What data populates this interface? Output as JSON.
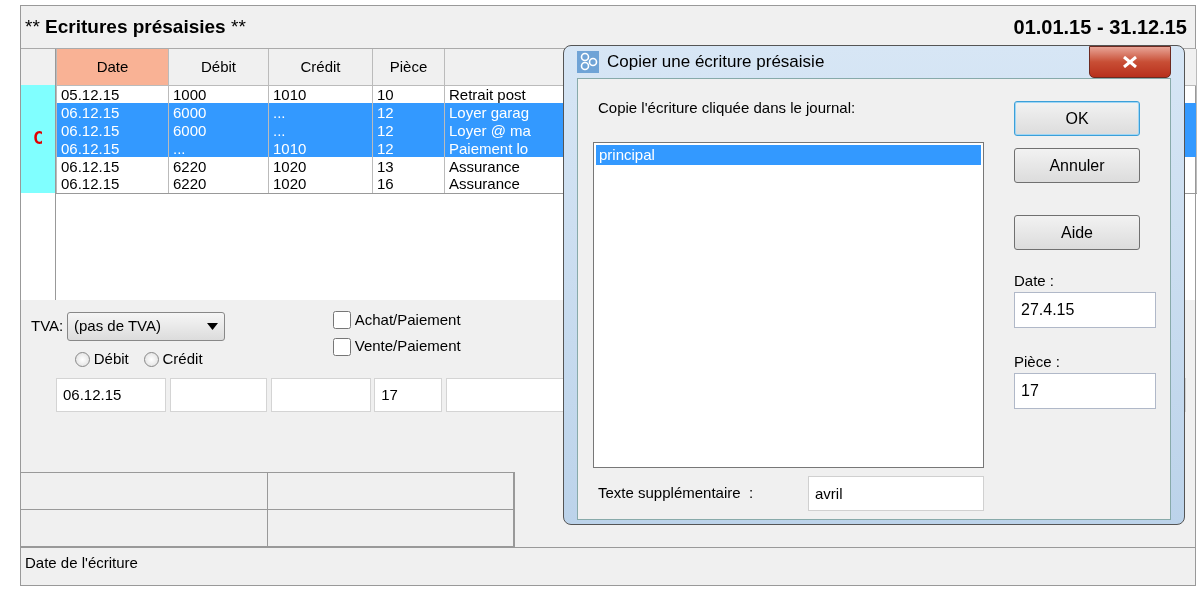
{
  "main": {
    "title_prefix": "**",
    "title": "Ecritures présaisies",
    "title_suffix": "**",
    "period": "01.01.15 - 31.12.15",
    "table": {
      "marker": "C",
      "columns": [
        {
          "label": "Date",
          "sorted": true
        },
        {
          "label": "Débit",
          "sorted": false
        },
        {
          "label": "Crédit",
          "sorted": false
        },
        {
          "label": "Pièce",
          "sorted": false
        }
      ],
      "rows": [
        {
          "cells": [
            "05.12.15",
            "1000",
            "1010",
            "10",
            "Retrait post"
          ],
          "selected": false
        },
        {
          "cells": [
            "06.12.15",
            "6000",
            "...",
            "12",
            "Loyer garag"
          ],
          "selected": true
        },
        {
          "cells": [
            "06.12.15",
            "6000",
            "...",
            "12",
            "Loyer @ ma"
          ],
          "selected": true
        },
        {
          "cells": [
            "06.12.15",
            "...",
            "1010",
            "12",
            "Paiement lo"
          ],
          "selected": true
        },
        {
          "cells": [
            "06.12.15",
            "6220",
            "1020",
            "13",
            "Assurance"
          ],
          "selected": false
        },
        {
          "cells": [
            "06.12.15",
            "6220",
            "1020",
            "16",
            "Assurance"
          ],
          "selected": false
        }
      ]
    },
    "form": {
      "vat_label": "TVA:",
      "vat_value": "(pas de TVA)",
      "radios": [
        {
          "label": "Débit",
          "selected": false
        },
        {
          "label": "Crédit",
          "selected": false
        }
      ],
      "checkboxes": [
        {
          "label": "Achat/Paiement",
          "checked": false
        },
        {
          "label": "Vente/Paiement",
          "checked": false
        }
      ],
      "entry": {
        "date": "06.12.15",
        "piece": "17"
      }
    },
    "status_bar": "Date de l'écriture"
  },
  "dialog": {
    "title": "Copier une écriture présaisie",
    "prompt": "Copie l'écriture cliquée dans le journal:",
    "journals": [
      {
        "label": "principal",
        "selected": true
      }
    ],
    "buttons": [
      {
        "label": "OK",
        "default": true
      },
      {
        "label": "Annuler",
        "default": false
      },
      {
        "label": "Aide",
        "default": false
      }
    ],
    "date_label": "Date :",
    "date_value": "27.4.15",
    "piece_label": "Pièce :",
    "piece_value": "17",
    "extra_label": "Texte supplémentaire  :",
    "extra_value": "avril"
  }
}
